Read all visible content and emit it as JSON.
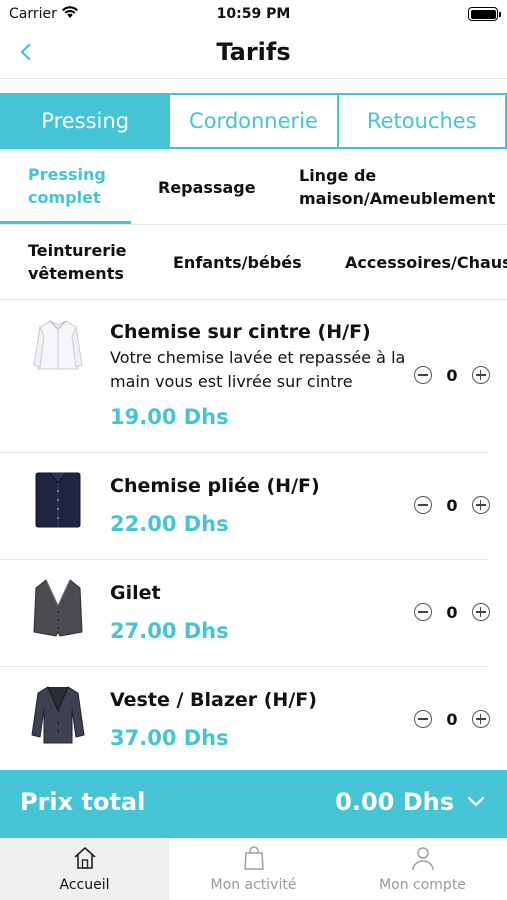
{
  "status_bar": {
    "carrier": "Carrier",
    "time": "10:59 PM"
  },
  "nav": {
    "title": "Tarifs",
    "back_icon": "chevron-left-icon"
  },
  "main_tabs": [
    {
      "label": "Pressing",
      "active": true
    },
    {
      "label": "Cordonnerie",
      "active": false
    },
    {
      "label": "Retouches",
      "active": false
    }
  ],
  "sub_categories": {
    "row1": [
      {
        "label_line1": "Pressing",
        "label_line2": "complet",
        "active": true
      },
      {
        "label_line1": "Repassage",
        "label_line2": "",
        "active": false
      },
      {
        "label_line1": "Linge de",
        "label_line2": "maison/Ameublement",
        "active": false
      }
    ],
    "row2": [
      {
        "label_line1": "Teinturerie",
        "label_line2": "vêtements"
      },
      {
        "label_line1": "Enfants/bébés",
        "label_line2": ""
      },
      {
        "label_line1": "Accessoires/Chauss",
        "label_line2": ""
      }
    ]
  },
  "products": [
    {
      "name": "Chemise sur cintre (H/F)",
      "description": "Votre chemise lavée et repassée à la main vous est livrée sur cintre",
      "price": "19.00 Dhs",
      "quantity": "0",
      "image": "white-shirt-image"
    },
    {
      "name": "Chemise pliée (H/F)",
      "description": "",
      "price": "22.00 Dhs",
      "quantity": "0",
      "image": "folded-navy-shirt-image"
    },
    {
      "name": "Gilet",
      "description": "",
      "price": "27.00 Dhs",
      "quantity": "0",
      "image": "grey-vest-image"
    },
    {
      "name": "Veste / Blazer (H/F)",
      "description": "",
      "price": "37.00 Dhs",
      "quantity": "0",
      "image": "blazer-image"
    }
  ],
  "total": {
    "label": "Prix total",
    "amount": "0.00 Dhs",
    "icon": "chevron-down-icon"
  },
  "tab_bar": [
    {
      "label": "Accueil",
      "icon": "home-icon",
      "active": true
    },
    {
      "label": "Mon activité",
      "icon": "bag-icon",
      "active": false
    },
    {
      "label": "Mon compte",
      "icon": "user-icon",
      "active": false
    }
  ],
  "colors": {
    "accent": "#45c4d6",
    "text": "#111111",
    "muted": "#9a9a9a",
    "tab_active_bg": "#f0f0f0"
  }
}
